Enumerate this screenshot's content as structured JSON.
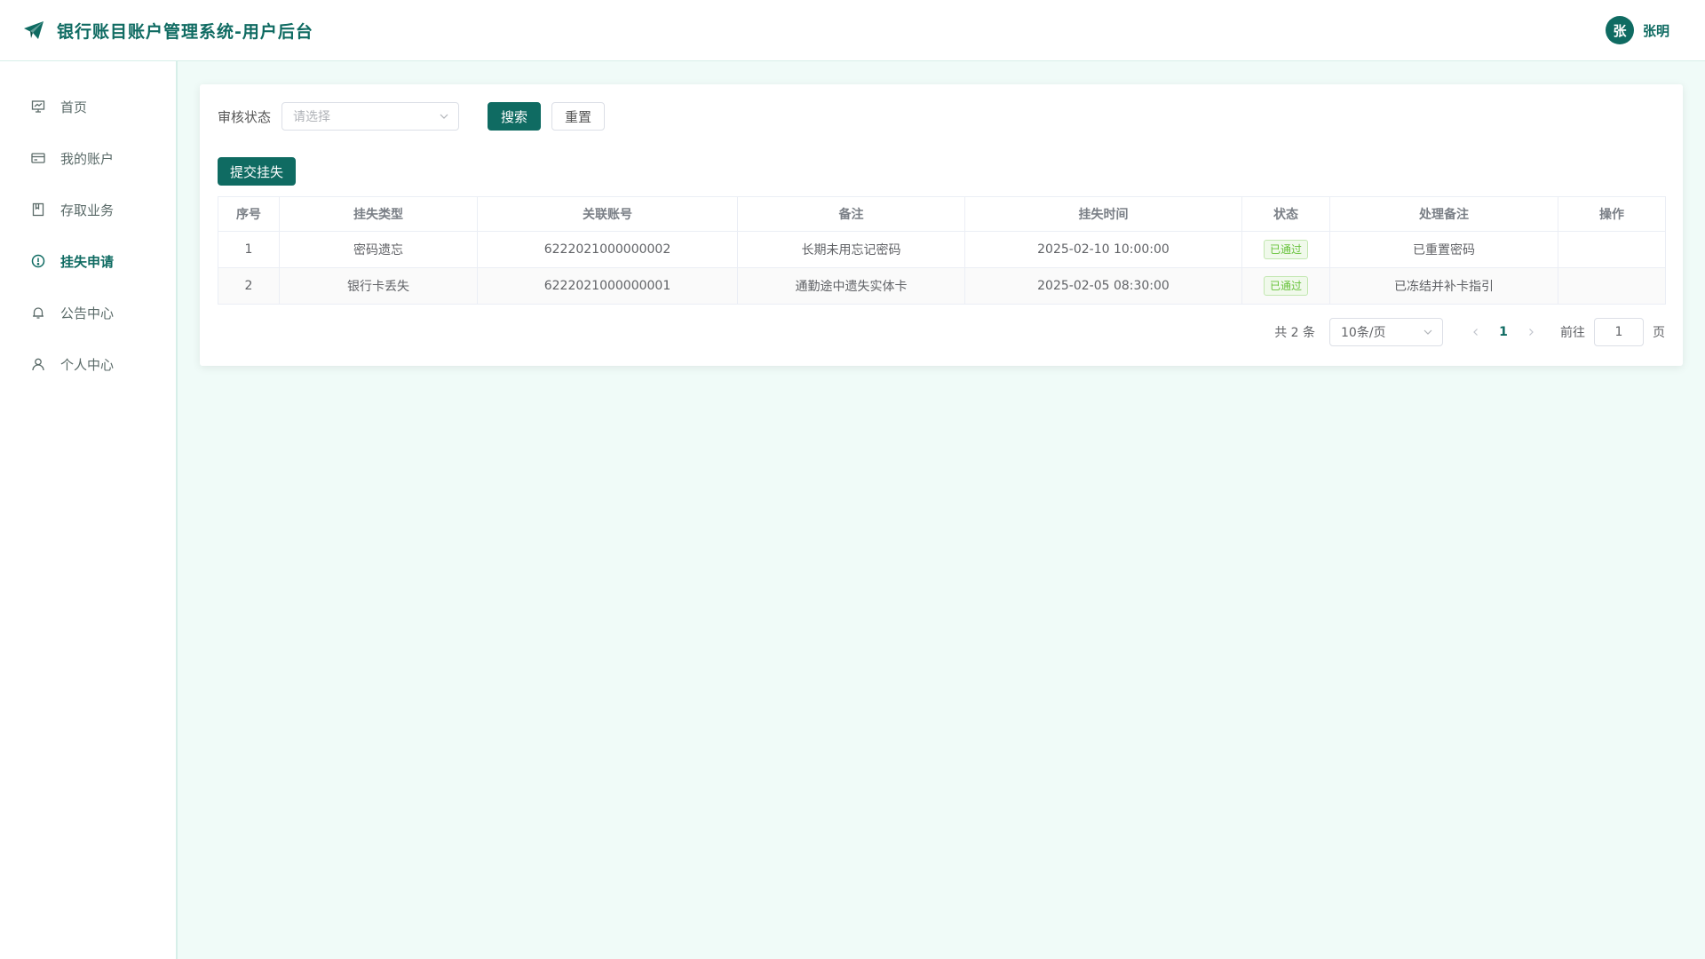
{
  "header": {
    "title": "银行账目账户管理系统-用户后台",
    "logo_icon": "paper-plane-icon",
    "user": {
      "avatar_text": "张",
      "name": "张明"
    }
  },
  "sidebar": {
    "items": [
      {
        "label": "首页",
        "icon": "dashboard-icon",
        "active": false
      },
      {
        "label": "我的账户",
        "icon": "card-icon",
        "active": false
      },
      {
        "label": "存取业务",
        "icon": "notebook-icon",
        "active": false
      },
      {
        "label": "挂失申请",
        "icon": "warning-circle-icon",
        "active": true
      },
      {
        "label": "公告中心",
        "icon": "bell-icon",
        "active": false
      },
      {
        "label": "个人中心",
        "icon": "user-icon",
        "active": false
      }
    ]
  },
  "filter": {
    "label": "审核状态",
    "select_placeholder": "请选择",
    "search_label": "搜索",
    "reset_label": "重置"
  },
  "toolbar": {
    "submit_label": "提交挂失"
  },
  "table": {
    "columns": [
      "序号",
      "挂失类型",
      "关联账号",
      "备注",
      "挂失时间",
      "状态",
      "处理备注",
      "操作"
    ],
    "rows": [
      {
        "index": "1",
        "type": "密码遗忘",
        "account": "6222021000000002",
        "remark": "长期未用忘记密码",
        "time": "2025-02-10 10:00:00",
        "status": "已通过",
        "handle_remark": "已重置密码",
        "action": ""
      },
      {
        "index": "2",
        "type": "银行卡丢失",
        "account": "6222021000000001",
        "remark": "通勤途中遗失实体卡",
        "time": "2025-02-05 08:30:00",
        "status": "已通过",
        "handle_remark": "已冻结并补卡指引",
        "action": ""
      }
    ]
  },
  "pagination": {
    "total_text": "共 2 条",
    "page_size": "10条/页",
    "current_page": "1",
    "goto_label": "前往",
    "goto_value": "1",
    "goto_suffix": "页"
  },
  "colors": {
    "brand": "#0f6b62",
    "background": "#f0fbf8",
    "success": "#67c23a"
  }
}
